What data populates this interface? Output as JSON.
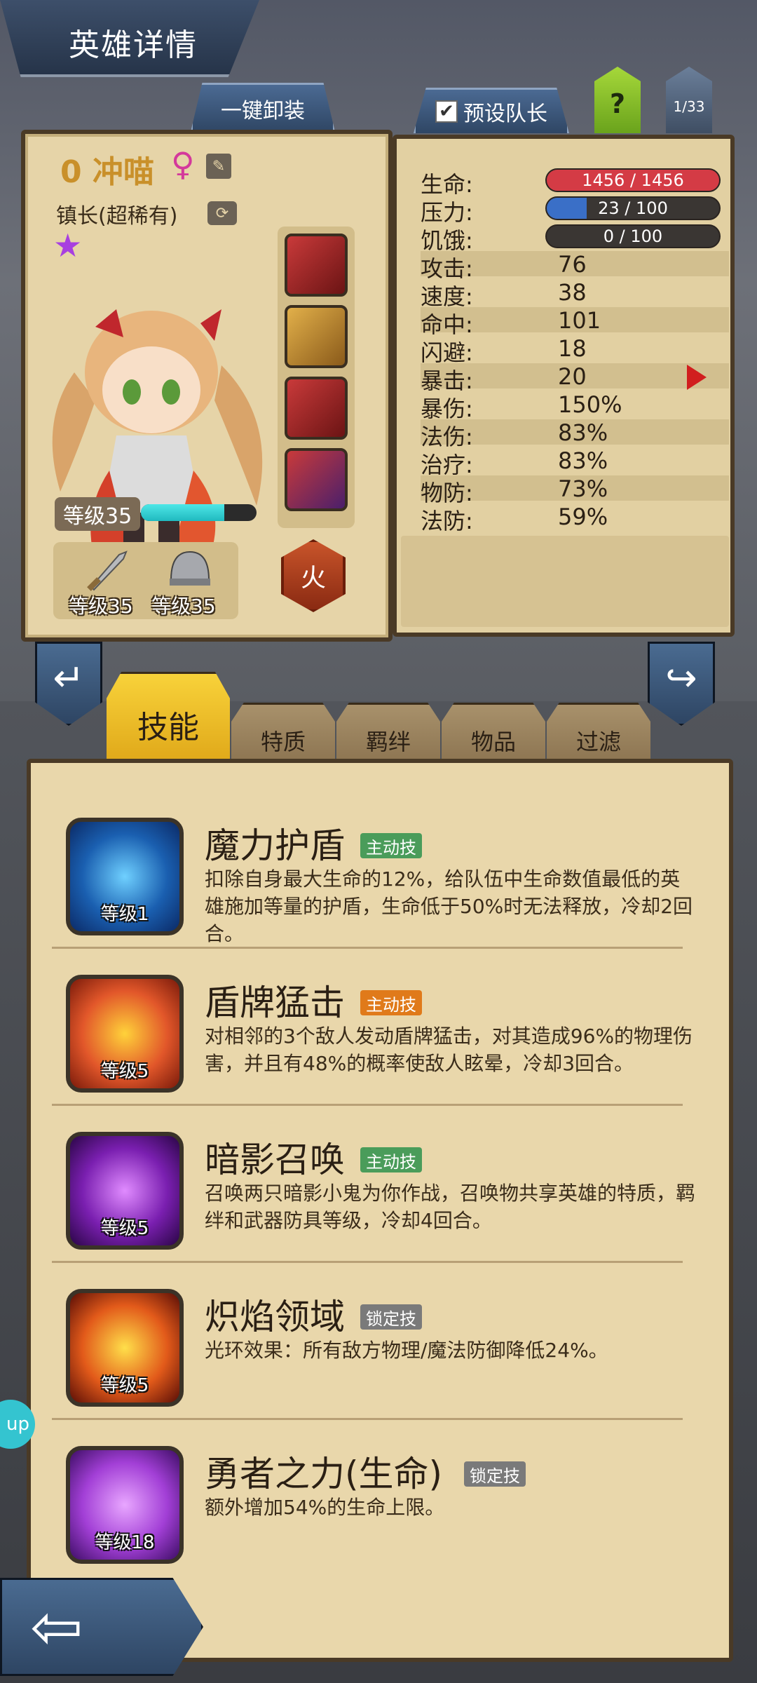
{
  "header": {
    "title": "英雄详情",
    "unequip_label": "一键卸装",
    "preset_label": "预设队长",
    "help_label": "?",
    "page_indicator": "1/33"
  },
  "hero": {
    "name": "0 冲喵",
    "gender_symbol": "♀",
    "title": "镇长(超稀有)",
    "level_label": "等级35",
    "xp_fraction": 0.72,
    "weapon_level": "等级35",
    "armor_level": "等级35",
    "element": "火"
  },
  "stats": {
    "hp": {
      "label": "生命:",
      "value": "1456 / 1456",
      "fraction": 1.0
    },
    "stress": {
      "label": "压力:",
      "value": "23 / 100",
      "fraction": 0.23
    },
    "hunger": {
      "label": "饥饿:",
      "value": "0 / 100",
      "fraction": 0.0
    },
    "rows": [
      {
        "label": "攻击:",
        "value": "76"
      },
      {
        "label": "速度:",
        "value": "38"
      },
      {
        "label": "命中:",
        "value": "101"
      },
      {
        "label": "闪避:",
        "value": "18"
      },
      {
        "label": "暴击:",
        "value": "20"
      },
      {
        "label": "暴伤:",
        "value": "150%"
      },
      {
        "label": "法伤:",
        "value": "83%"
      },
      {
        "label": "治疗:",
        "value": "83%"
      },
      {
        "label": "物防:",
        "value": "73%"
      },
      {
        "label": "法防:",
        "value": "59%"
      }
    ]
  },
  "tabs": [
    {
      "label": "技能",
      "active": true
    },
    {
      "label": "特质",
      "active": false
    },
    {
      "label": "羁绊",
      "active": false
    },
    {
      "label": "物品",
      "active": false
    },
    {
      "label": "过滤",
      "active": false
    }
  ],
  "skills": [
    {
      "name": "魔力护盾",
      "tag": "主动技",
      "tag_color": "#4a9c5a",
      "level": "等级1",
      "desc": "扣除自身最大生命的12%，给队伍中生命数值最低的英雄施加等量的护盾，生命低于50%时无法释放，冷却2回合。"
    },
    {
      "name": "盾牌猛击",
      "tag": "主动技",
      "tag_color": "#e07a1a",
      "level": "等级5",
      "desc": "对相邻的3个敌人发动盾牌猛击，对其造成96%的物理伤害，并且有48%的概率使敌人眩晕，冷却3回合。"
    },
    {
      "name": "暗影召唤",
      "tag": "主动技",
      "tag_color": "#4a9c5a",
      "level": "等级5",
      "desc": "召唤两只暗影小鬼为你作战，召唤物共享英雄的特质，羁绊和武器防具等级，冷却4回合。"
    },
    {
      "name": "炽焰领域",
      "tag": "锁定技",
      "tag_color": "#7a7a7a",
      "level": "等级5",
      "desc": "光环效果：所有敌方物理/魔法防御降低24%。"
    },
    {
      "name": "勇者之力(生命)",
      "tag": "锁定技",
      "tag_color": "#7a7a7a",
      "level": "等级18",
      "desc": "额外增加54%的生命上限。"
    }
  ],
  "side_bubble": "up",
  "colors": {
    "hp": "#d43b45",
    "stress": "#3a6fc7",
    "accent_tab": "#f2c52c"
  }
}
